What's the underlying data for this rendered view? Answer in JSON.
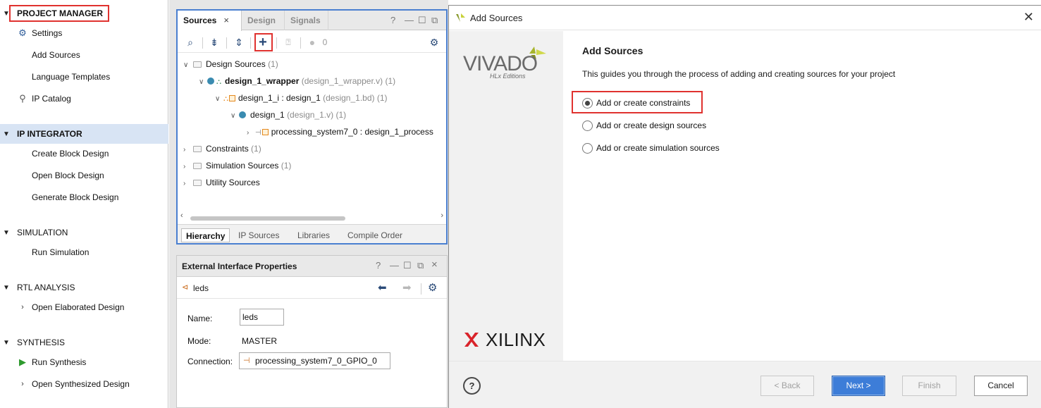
{
  "flow_navigator": {
    "project_manager": {
      "title": "PROJECT MANAGER",
      "items": [
        "Settings",
        "Add Sources",
        "Language Templates",
        "IP Catalog"
      ]
    },
    "ip_integrator": {
      "title": "IP INTEGRATOR",
      "items": [
        "Create Block Design",
        "Open Block Design",
        "Generate Block Design"
      ]
    },
    "simulation": {
      "title": "SIMULATION",
      "items": [
        "Run Simulation"
      ]
    },
    "rtl_analysis": {
      "title": "RTL ANALYSIS",
      "items": [
        "Open Elaborated Design"
      ]
    },
    "synthesis": {
      "title": "SYNTHESIS",
      "items": [
        "Run Synthesis",
        "Open Synthesized Design"
      ]
    }
  },
  "sources_panel": {
    "tabs": [
      "Sources",
      "Design",
      "Signals"
    ],
    "tab_close": "×",
    "warning_count": "0",
    "tree": {
      "design_sources": {
        "label": "Design Sources",
        "count": "(1)"
      },
      "wrapper": {
        "name": "design_1_wrapper",
        "file": "(design_1_wrapper.v)",
        "count": "(1)"
      },
      "design_1_i": {
        "name": "design_1_i : design_1",
        "file": "(design_1.bd)",
        "count": "(1)"
      },
      "design_1": {
        "name": "design_1",
        "file": "(design_1.v)",
        "count": "(1)"
      },
      "ps7": {
        "name": "processing_system7_0 : design_1_process"
      },
      "constraints": {
        "label": "Constraints",
        "count": "(1)"
      },
      "simulation_sources": {
        "label": "Simulation Sources",
        "count": "(1)"
      },
      "utility_sources": {
        "label": "Utility Sources"
      }
    },
    "bottom_tabs": [
      "Hierarchy",
      "IP Sources",
      "Libraries",
      "Compile Order"
    ]
  },
  "ext_props": {
    "title": "External Interface Properties",
    "object": "leds",
    "name_label": "Name:",
    "name_value": "leds",
    "mode_label": "Mode:",
    "mode_value": "MASTER",
    "connection_label": "Connection:",
    "connection_value": "processing_system7_0_GPIO_0"
  },
  "dialog": {
    "title": "Add Sources",
    "heading": "Add Sources",
    "description": "This guides you through the process of adding and creating sources for your project",
    "options": [
      {
        "label": "Add or create constraints",
        "selected": true
      },
      {
        "label": "Add or create design sources",
        "selected": false
      },
      {
        "label": "Add or create simulation sources",
        "selected": false
      }
    ],
    "vivado_logo": "VIVADO",
    "vivado_sub": "HLx Editions",
    "xilinx_logo": "XILINX",
    "buttons": {
      "help": "?",
      "back": "< Back",
      "next": "Next >",
      "finish": "Finish",
      "cancel": "Cancel"
    }
  },
  "colors": {
    "highlight_red": "#e0322f",
    "panel_border_blue": "#4a7fd0",
    "primary_button": "#3d7dd8",
    "selected_section": "#d8e4f4"
  }
}
